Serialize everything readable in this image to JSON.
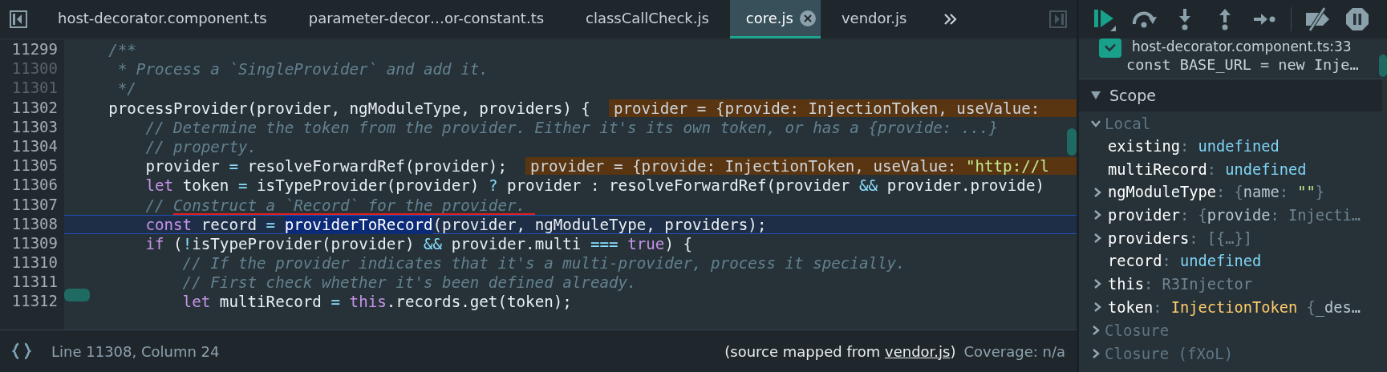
{
  "tabs": [
    {
      "label": "host-decorator.component.ts",
      "selected": false,
      "closable": false
    },
    {
      "label": "parameter-decor…or-constant.ts",
      "selected": false,
      "closable": false
    },
    {
      "label": "classCallCheck.js",
      "selected": false,
      "closable": false
    },
    {
      "label": "core.js",
      "selected": true,
      "closable": true
    },
    {
      "label": "vendor.js",
      "selected": false,
      "closable": false
    }
  ],
  "code": {
    "lines": [
      {
        "number": "11299",
        "executable": true,
        "current": false,
        "marked": false,
        "tokens": [
          {
            "kind": "comment",
            "text": "    /**"
          }
        ]
      },
      {
        "number": "11300",
        "executable": false,
        "current": false,
        "marked": false,
        "tokens": [
          {
            "kind": "comment",
            "text": "     * Process a `SingleProvider` and add it."
          }
        ]
      },
      {
        "number": "11301",
        "executable": false,
        "current": false,
        "marked": false,
        "tokens": [
          {
            "kind": "comment",
            "text": "     */"
          }
        ]
      },
      {
        "number": "11302",
        "executable": true,
        "current": false,
        "marked": false,
        "tokens": [
          {
            "kind": "plain",
            "text": "    processProvider(provider, ngModuleType, providers) {"
          }
        ],
        "annotation": [
          {
            "kind": "plain",
            "text": "provider = {provide: InjectionToken, useValue:"
          }
        ]
      },
      {
        "number": "11303",
        "executable": true,
        "current": false,
        "marked": false,
        "tokens": [
          {
            "kind": "comment",
            "text": "        // Determine the token from the provider. Either it's its own token, or has a {provide: ...}"
          }
        ]
      },
      {
        "number": "11304",
        "executable": true,
        "current": false,
        "marked": false,
        "tokens": [
          {
            "kind": "comment",
            "text": "        // property."
          }
        ]
      },
      {
        "number": "11305",
        "executable": true,
        "current": false,
        "marked": false,
        "tokens": [
          {
            "kind": "plain",
            "text": "        provider "
          },
          {
            "kind": "operator",
            "text": "="
          },
          {
            "kind": "plain",
            "text": " resolveForwardRef(provider);"
          }
        ],
        "annotation": [
          {
            "kind": "plain",
            "text": "provider = {provide: InjectionToken, useValue: "
          },
          {
            "kind": "string",
            "text": "\"http://l"
          }
        ]
      },
      {
        "number": "11306",
        "executable": true,
        "current": false,
        "marked": false,
        "tokens": [
          {
            "kind": "keyword",
            "text": "        let"
          },
          {
            "kind": "plain",
            "text": " token "
          },
          {
            "kind": "operator",
            "text": "="
          },
          {
            "kind": "plain",
            "text": " isTypeProvider(provider) "
          },
          {
            "kind": "operator",
            "text": "?"
          },
          {
            "kind": "plain",
            "text": " provider : resolveForwardRef(provider "
          },
          {
            "kind": "operator",
            "text": "&&"
          },
          {
            "kind": "plain",
            "text": " provider.provide)"
          }
        ]
      },
      {
        "number": "11307",
        "executable": true,
        "current": false,
        "marked": true,
        "tokens": [
          {
            "kind": "comment",
            "text": "        // Construct a `Record` for the provider."
          }
        ]
      },
      {
        "number": "11308",
        "executable": true,
        "current": true,
        "marked": false,
        "tokens": [
          {
            "kind": "keyword",
            "text": "        const"
          },
          {
            "kind": "plain",
            "text": " record "
          },
          {
            "kind": "operator",
            "text": "= "
          },
          {
            "kind": "selected",
            "text": "providerToRecord"
          },
          {
            "kind": "plain",
            "text": "(provider, ngModuleType, providers);"
          }
        ]
      },
      {
        "number": "11309",
        "executable": true,
        "current": false,
        "marked": false,
        "tokens": [
          {
            "kind": "keyword",
            "text": "        if"
          },
          {
            "kind": "plain",
            "text": " ("
          },
          {
            "kind": "operator",
            "text": "!"
          },
          {
            "kind": "plain",
            "text": "isTypeProvider(provider) "
          },
          {
            "kind": "operator",
            "text": "&&"
          },
          {
            "kind": "plain",
            "text": " provider.multi "
          },
          {
            "kind": "operator",
            "text": "=== "
          },
          {
            "kind": "keyword",
            "text": "true"
          },
          {
            "kind": "plain",
            "text": ") {"
          }
        ]
      },
      {
        "number": "11310",
        "executable": true,
        "current": false,
        "marked": false,
        "tokens": [
          {
            "kind": "comment",
            "text": "            // If the provider indicates that it's a multi-provider, process it specially."
          }
        ]
      },
      {
        "number": "11311",
        "executable": true,
        "current": false,
        "marked": false,
        "tokens": [
          {
            "kind": "comment",
            "text": "            // First check whether it's been defined already."
          }
        ]
      },
      {
        "number": "11312",
        "executable": true,
        "current": false,
        "marked": false,
        "tokens": [
          {
            "kind": "keyword",
            "text": "            let"
          },
          {
            "kind": "plain",
            "text": " multiRecord "
          },
          {
            "kind": "operator",
            "text": "= "
          },
          {
            "kind": "keyword",
            "text": "this"
          },
          {
            "kind": "plain",
            "text": ".records.get(token);"
          }
        ]
      }
    ]
  },
  "status_bar": {
    "position": "Line 11308, Column 24",
    "source_prefix": "(source mapped from ",
    "source_link": "vendor.js",
    "source_suffix": ")",
    "coverage": "Coverage: n/a"
  },
  "debugger": {
    "breakpoint": {
      "checked": true,
      "location": "host-decorator.component.ts:33",
      "code": "const BASE_URL = new Inje…"
    },
    "scope": {
      "title": "Scope",
      "expanded": true,
      "sections": [
        {
          "name": "Local",
          "expanded": true,
          "children": [
            {
              "name": "existing",
              "expandable": false,
              "value": [
                {
                  "kind": "punct",
                  "text": ": "
                },
                {
                  "kind": "literal",
                  "text": "undefined"
                }
              ]
            },
            {
              "name": "multiRecord",
              "expandable": false,
              "value": [
                {
                  "kind": "punct",
                  "text": ": "
                },
                {
                  "kind": "literal",
                  "text": "undefined"
                }
              ]
            },
            {
              "name": "ngModuleType",
              "expandable": true,
              "value": [
                {
                  "kind": "punct",
                  "text": ": {"
                },
                {
                  "kind": "key",
                  "text": "name"
                },
                {
                  "kind": "punct",
                  "text": ": "
                },
                {
                  "kind": "string",
                  "text": "\"\""
                },
                {
                  "kind": "punct",
                  "text": "}"
                }
              ]
            },
            {
              "name": "provider",
              "expandable": true,
              "value": [
                {
                  "kind": "punct",
                  "text": ": {"
                },
                {
                  "kind": "key",
                  "text": "provide"
                },
                {
                  "kind": "punct",
                  "text": ": Injecti…"
                }
              ]
            },
            {
              "name": "providers",
              "expandable": true,
              "value": [
                {
                  "kind": "punct",
                  "text": ": [{…}]"
                }
              ]
            },
            {
              "name": "record",
              "expandable": false,
              "value": [
                {
                  "kind": "punct",
                  "text": ": "
                },
                {
                  "kind": "literal",
                  "text": "undefined"
                }
              ]
            },
            {
              "name": "this",
              "expandable": true,
              "value": [
                {
                  "kind": "punct",
                  "text": ": R3Injector"
                }
              ]
            },
            {
              "name": "token",
              "expandable": true,
              "value": [
                {
                  "kind": "punct",
                  "text": ": "
                },
                {
                  "kind": "class",
                  "text": "InjectionToken"
                },
                {
                  "kind": "punct",
                  "text": " {"
                },
                {
                  "kind": "key",
                  "text": "_des…"
                }
              ]
            }
          ]
        },
        {
          "name": "Closure",
          "expanded": false
        },
        {
          "name": "Closure (fXoL)",
          "expanded": false
        }
      ]
    }
  }
}
